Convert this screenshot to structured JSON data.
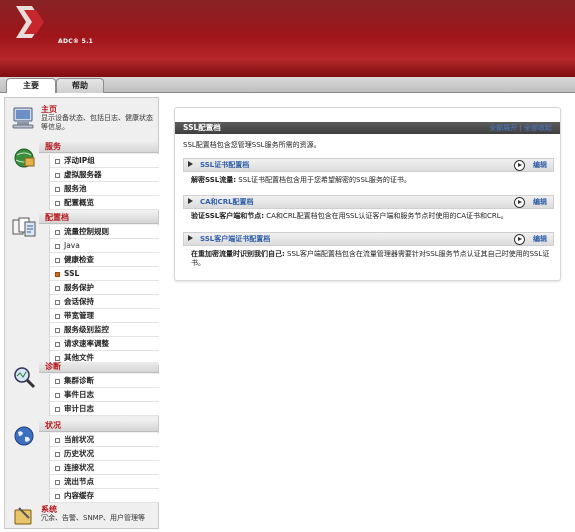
{
  "header": {
    "product": "ADC® 5.1"
  },
  "tabs": [
    {
      "label": "主要"
    },
    {
      "label": "帮助"
    }
  ],
  "sidebar": {
    "home": {
      "title": "主页",
      "desc": "显示设备状态、包括日志、健康状态等信息。"
    },
    "services": {
      "title": "服务",
      "items": [
        "浮动IP组",
        "虚拟服务器",
        "服务池",
        "配置概览"
      ]
    },
    "profiles": {
      "title": "配置档",
      "items": [
        "流量控制规则",
        "Java",
        "健康检查",
        "SSL",
        "服务保护",
        "会话保持",
        "带宽管理",
        "服务级别监控",
        "请求速率调整",
        "其他文件"
      ]
    },
    "diagnostics": {
      "title": "诊断",
      "items": [
        "集群诊断",
        "事件日志",
        "审计日志"
      ]
    },
    "status": {
      "title": "状况",
      "items": [
        "当前状况",
        "历史状况",
        "连接状况",
        "流出节点",
        "内容缓存"
      ]
    },
    "system": {
      "title": "系统",
      "desc": "冗余、告警、SNMP、用户管理等"
    }
  },
  "main": {
    "title": "SSL配置档",
    "links": "全部展开 | 全部收起",
    "intro": "SSL配置档包含您管理SSL服务所需的资源。",
    "edit_label": "编辑",
    "sections": [
      {
        "label": "SSL证书配置档",
        "desc_bold": "解密SSL流量:",
        "desc": " SSL证书配置档包含用于您希望解密的SSL服务的证书。"
      },
      {
        "label": "CA和CRL配置档",
        "desc_bold": "验证SSL客户端和节点:",
        "desc": " CA和CRL配置档包含在用SSL认证客户端和服务节点时使用的CA证书和CRL。"
      },
      {
        "label": "SSL客户端证书配置档",
        "desc_bold": "在重加密流量时识别我们自己:",
        "desc": " SSL客户端配置档包含在流量管理器需要针对SSL服务节点认证其自己时使用的SSL证书。"
      }
    ]
  }
}
